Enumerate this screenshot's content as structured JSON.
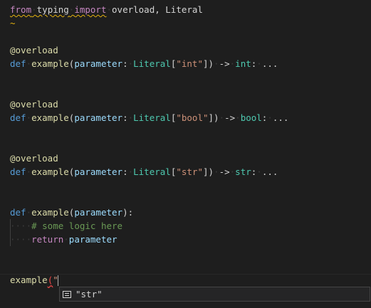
{
  "editor": {
    "import_line": {
      "kw_from": "from",
      "module": "typing",
      "kw_import": "import",
      "names": "overload, Literal"
    },
    "squiggle_marker": "~",
    "overloads": [
      {
        "decorator": "@overload",
        "kw_def": "def",
        "fn_name": "example",
        "param": "parameter",
        "literal_type": "Literal",
        "literal_value": "\"int\"",
        "return_type": "int",
        "body": "..."
      },
      {
        "decorator": "@overload",
        "kw_def": "def",
        "fn_name": "example",
        "param": "parameter",
        "literal_type": "Literal",
        "literal_value": "\"bool\"",
        "return_type": "bool",
        "body": "..."
      },
      {
        "decorator": "@overload",
        "kw_def": "def",
        "fn_name": "example",
        "param": "parameter",
        "literal_type": "Literal",
        "literal_value": "\"str\"",
        "return_type": "str",
        "body": "..."
      }
    ],
    "impl": {
      "kw_def": "def",
      "fn_name": "example",
      "param": "parameter",
      "comment": "# some logic here",
      "kw_return": "return",
      "return_value": "parameter"
    },
    "call_line": {
      "fn_name": "example",
      "open_paren": "(",
      "partial_arg": "\""
    }
  },
  "suggest": {
    "items": [
      {
        "label": "\"str\"",
        "icon": "text-value-icon"
      }
    ]
  }
}
